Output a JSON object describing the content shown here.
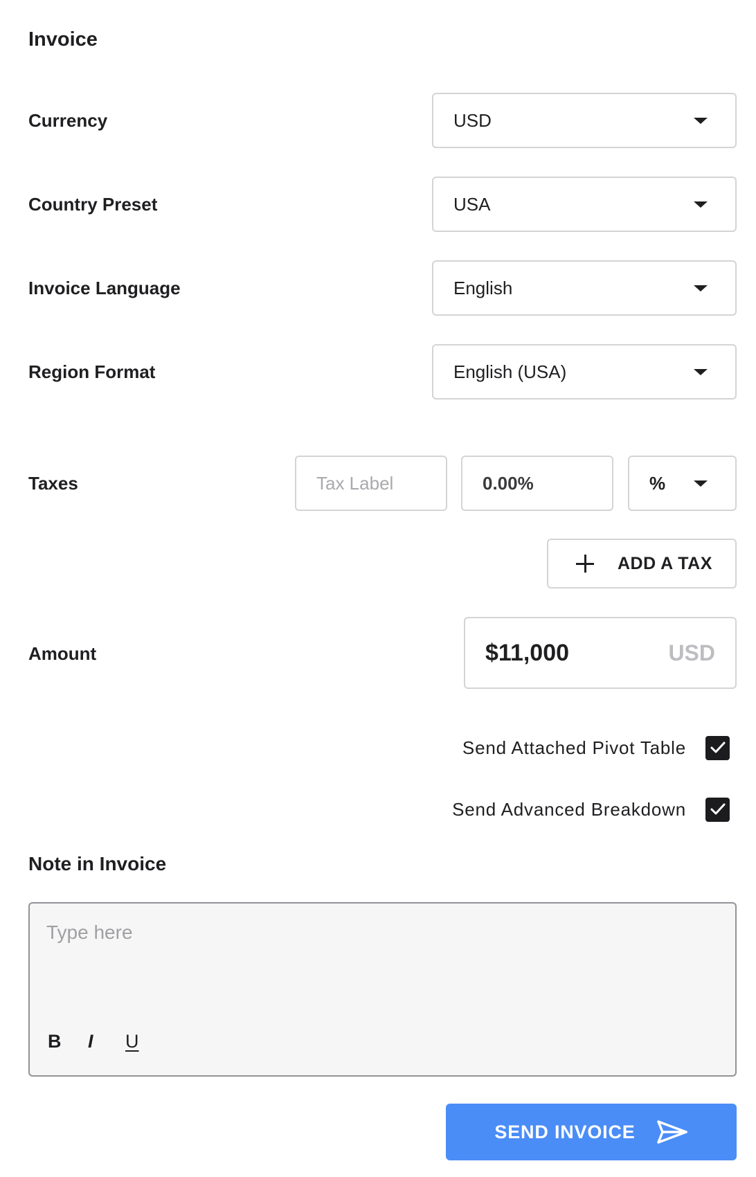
{
  "invoice": {
    "title": "Invoice",
    "currency": {
      "label": "Currency",
      "value": "USD"
    },
    "country_preset": {
      "label": "Country Preset",
      "value": "USA"
    },
    "invoice_language": {
      "label": "Invoice Language",
      "value": "English"
    },
    "region_format": {
      "label": "Region Format",
      "value": "English (USA)"
    },
    "taxes": {
      "label": "Taxes",
      "tax_label_placeholder": "Tax Label",
      "rate_value": "0.00%",
      "type_value": "%",
      "add_button_label": "ADD A TAX"
    },
    "amount": {
      "label": "Amount",
      "value": "$11,000",
      "currency": "USD"
    },
    "options": [
      {
        "label": "Send Attached Pivot Table",
        "checked": true
      },
      {
        "label": "Send Advanced Breakdown",
        "checked": true
      }
    ],
    "note": {
      "title": "Note in Invoice",
      "placeholder": "Type here",
      "format_buttons": {
        "bold": "B",
        "italic": "I",
        "underline": "U"
      }
    },
    "send_button_label": "SEND INVOICE"
  },
  "colors": {
    "accent": "#4a8df6",
    "border": "#d4d4d6",
    "note_background": "#f6f6f6",
    "checkbox_fill": "#1c1c1e",
    "placeholder": "#a9a9ad"
  },
  "icons": {
    "dropdown": "caret-down-icon",
    "add": "plus-icon",
    "checkbox": "checkmark-icon",
    "send": "paper-plane-icon"
  }
}
